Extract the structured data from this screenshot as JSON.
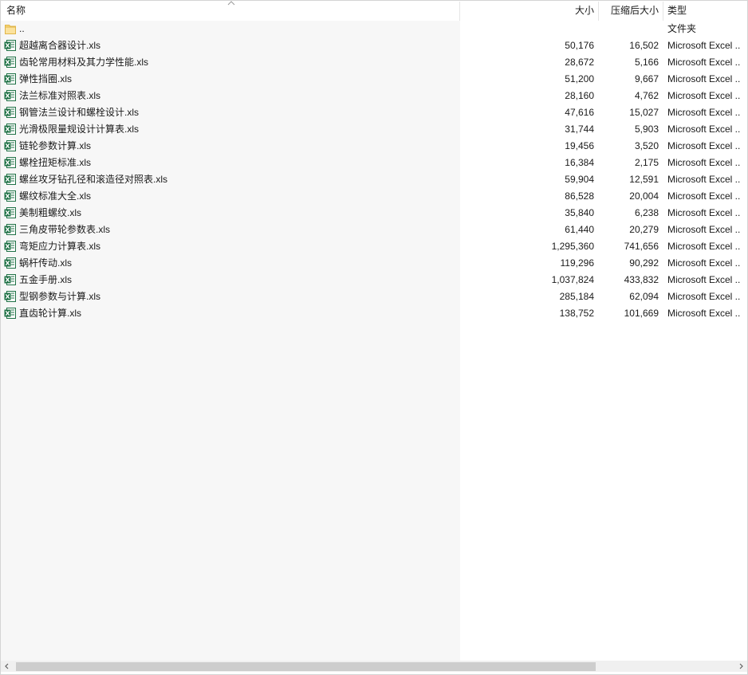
{
  "columns": {
    "name": "名称",
    "size": "大小",
    "packed": "压缩后大小",
    "type": "类型"
  },
  "parent_row": {
    "name": "..",
    "type": "文件夹",
    "icon": "folder-icon"
  },
  "files": [
    {
      "name": "超越离合器设计.xls",
      "size": "50,176",
      "packed": "16,502",
      "type": "Microsoft Excel ..",
      "icon": "excel-file-icon"
    },
    {
      "name": "齿轮常用材料及其力学性能.xls",
      "size": "28,672",
      "packed": "5,166",
      "type": "Microsoft Excel ..",
      "icon": "excel-file-icon"
    },
    {
      "name": "弹性挡圈.xls",
      "size": "51,200",
      "packed": "9,667",
      "type": "Microsoft Excel ..",
      "icon": "excel-file-icon"
    },
    {
      "name": "法兰标准对照表.xls",
      "size": "28,160",
      "packed": "4,762",
      "type": "Microsoft Excel ..",
      "icon": "excel-file-icon"
    },
    {
      "name": "钢管法兰设计和螺栓设计.xls",
      "size": "47,616",
      "packed": "15,027",
      "type": "Microsoft Excel ..",
      "icon": "excel-file-icon"
    },
    {
      "name": "光滑极限量规设计计算表.xls",
      "size": "31,744",
      "packed": "5,903",
      "type": "Microsoft Excel ..",
      "icon": "excel-file-icon"
    },
    {
      "name": "链轮参数计算.xls",
      "size": "19,456",
      "packed": "3,520",
      "type": "Microsoft Excel ..",
      "icon": "excel-file-icon"
    },
    {
      "name": "螺栓扭矩标准.xls",
      "size": "16,384",
      "packed": "2,175",
      "type": "Microsoft Excel ..",
      "icon": "excel-file-icon"
    },
    {
      "name": "螺丝攻牙钻孔径和滚造径对照表.xls",
      "size": "59,904",
      "packed": "12,591",
      "type": "Microsoft Excel ..",
      "icon": "excel-file-icon"
    },
    {
      "name": "螺纹标准大全.xls",
      "size": "86,528",
      "packed": "20,004",
      "type": "Microsoft Excel ..",
      "icon": "excel-file-icon"
    },
    {
      "name": "美制粗螺纹.xls",
      "size": "35,840",
      "packed": "6,238",
      "type": "Microsoft Excel ..",
      "icon": "excel-file-icon"
    },
    {
      "name": "三角皮带轮参数表.xls",
      "size": "61,440",
      "packed": "20,279",
      "type": "Microsoft Excel ..",
      "icon": "excel-file-icon"
    },
    {
      "name": "弯矩应力计算表.xls",
      "size": "1,295,360",
      "packed": "741,656",
      "type": "Microsoft Excel ..",
      "icon": "excel-file-icon"
    },
    {
      "name": "蜗杆传动.xls",
      "size": "119,296",
      "packed": "90,292",
      "type": "Microsoft Excel ..",
      "icon": "excel-file-icon"
    },
    {
      "name": "五金手册.xls",
      "size": "1,037,824",
      "packed": "433,832",
      "type": "Microsoft Excel ..",
      "icon": "excel-file-icon"
    },
    {
      "name": "型钢参数与计算.xls",
      "size": "285,184",
      "packed": "62,094",
      "type": "Microsoft Excel ..",
      "icon": "excel-file-icon"
    },
    {
      "name": "直齿轮计算.xls",
      "size": "138,752",
      "packed": "101,669",
      "type": "Microsoft Excel ..",
      "icon": "excel-file-icon"
    }
  ],
  "sort": {
    "column": "name",
    "direction": "ascending",
    "icon": "sort-ascending-icon"
  },
  "scrollbar": {
    "horizontal_position": 0,
    "visible_fraction": 0.81,
    "left_icon": "scroll-left-icon",
    "right_icon": "scroll-right-icon"
  },
  "colors": {
    "name_column_bg": "#f7f7f7",
    "excel_icon": "#1e7145",
    "folder_icon": "#f8d775",
    "scroll_thumb": "#cdcdcd",
    "scroll_track": "#f0f0f0"
  }
}
